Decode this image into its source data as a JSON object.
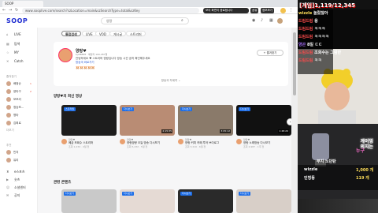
{
  "browser": {
    "tab_title": "SOOP",
    "url": "www.sooplive.com/search?szLocation=main&szSearchType=total&szKey",
    "overlay_text": "보이 화면이 종료됩니다",
    "overlay_buttons": [
      "공유",
      "정보보기"
    ]
  },
  "site": {
    "logo": "SOOP",
    "search_value": "양랑"
  },
  "sidebar": {
    "nav": [
      {
        "icon": "home",
        "label": "LIVE"
      },
      {
        "icon": "grid",
        "label": "탐색"
      },
      {
        "icon": "star",
        "label": "MY"
      },
      {
        "icon": "catch",
        "label": "Catch"
      }
    ],
    "fav_header": "즐겨찾기",
    "favs": [
      {
        "name": "배정순",
        "count": "1"
      },
      {
        "name": "양타구",
        "count": "2"
      },
      {
        "name": "모모리",
        "count": ""
      },
      {
        "name": "정승조...",
        "count": ""
      },
      {
        "name": "명타",
        "count": ""
      },
      {
        "name": "김희로",
        "count": ""
      }
    ],
    "fav_more": "더보기",
    "rec_header": "추천",
    "recs": [
      {
        "name": "민지"
      },
      {
        "name": "유리"
      }
    ],
    "bottom": [
      "e스포츠",
      "숏츠",
      "소셜센터",
      "공지"
    ]
  },
  "main": {
    "filters": [
      {
        "label": "통합검색",
        "active": true
      },
      {
        "label": "LIVE",
        "active": false
      },
      {
        "label": "VOD",
        "active": false
      },
      {
        "label": "게시글",
        "active": false
      },
      {
        "label": "스트리머",
        "active": false
      }
    ],
    "profile": {
      "name": "양랑♥",
      "meta": "bjid8888 · 애청자 100,287명",
      "desc": "안녕하세요 ♥ 스트리머 양랑입니다 방송 시간 공지 확인해주세요",
      "link": "방송국 바로가기",
      "emoji": "🐹🐹🐹🐹🐹",
      "follow_btn": "+ 즐겨찾기",
      "more": "방송국 자세히 ⌄"
    },
    "recent_title": "양랑♥의 최신 영상",
    "videos": [
      {
        "badge": "스트리밍",
        "dur": "",
        "ch": "양랑♥",
        "title": "폐급 조회수 스트리머",
        "meta": "조회 1,234 · 4일 전",
        "color": "#1d1d1d"
      },
      {
        "badge": "다시보기",
        "dur": "2:15:35",
        "ch": "양랑♥",
        "title": "양랑양랑 오늘 방송 다시보기",
        "meta": "조회 5,432 · 5일 전",
        "color": "#b98c74"
      },
      {
        "badge": "다시보기",
        "dur": "3:05:12",
        "ch": "양랑♥",
        "title": "양랑 커피 카페 투어 브이로그",
        "meta": "조회 3,210 · 6일 전",
        "color": "#8a7a6a"
      },
      {
        "badge": "다시보기",
        "dur": "1:48:20",
        "ch": "양랑♥",
        "title": "양랑 노래방송 다시보기",
        "meta": "조회 2,987 · 1주 전",
        "color": "#111111"
      }
    ],
    "related_title": "관련 콘텐츠",
    "related": [
      {
        "badge": "다시보기",
        "color": "#c9c9c9"
      },
      {
        "badge": "다시보기",
        "color": "#e5dad4"
      },
      {
        "badge": "다시보기",
        "color": "#2a2a2a"
      },
      {
        "badge": "다시보기",
        "color": "#d8cfc8"
      }
    ]
  },
  "stream": {
    "top_text": "[게임]1,119/12,345",
    "chat": [
      {
        "user": "wizzle",
        "msg": "놀랐잖아",
        "cls": "u2"
      },
      {
        "user": "드림드림",
        "msg": "응",
        "cls": "u"
      },
      {
        "user": "드림드림",
        "msg": "ㅋㅋㅋ",
        "cls": "u"
      },
      {
        "user": "드림드림",
        "msg": "ㅋㅋㅋㅋ",
        "cls": "u"
      },
      {
        "user": "양곤",
        "msg": "8일 ㄷㄷ",
        "cls": "u3"
      },
      {
        "user": "드림드림",
        "msg": "조회수는 그럼반",
        "cls": "u"
      },
      {
        "user": "드림드림",
        "msg": "ㅋㅋ",
        "cls": "u"
      }
    ],
    "neon": [
      "게이밍",
      "의지는"
    ],
    "neon_pink": "누구",
    "lb_title": "부지 노던탄",
    "leaderboard": [
      {
        "name": "wizzle",
        "val": "1,000 개"
      },
      {
        "name": "인띵동",
        "val": "119 개"
      }
    ]
  }
}
